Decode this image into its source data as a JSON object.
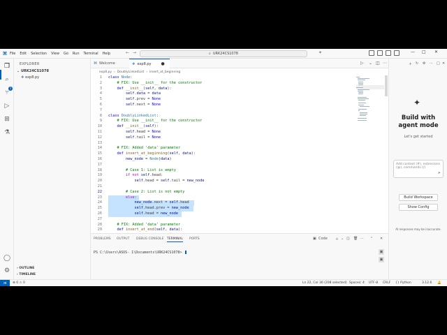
{
  "app": {
    "search_text": "URK24CS1078",
    "menu": [
      "File",
      "Edit",
      "Selection",
      "View",
      "Go",
      "Run",
      "Terminal",
      "Help"
    ]
  },
  "sidebar": {
    "header": "EXPLORER",
    "folder": "URK24CS1078",
    "file": "exp8.py",
    "outline": "OUTLINE",
    "timeline": "TIMELINE"
  },
  "tabs": [
    {
      "label": "Welcome"
    },
    {
      "label": "exp8.py"
    }
  ],
  "breadcrumb": [
    "exp8.py",
    "DoublyLinkedList",
    "insert_at_beginning"
  ],
  "editor": {
    "lines": [
      {
        "n": "1",
        "text": "class Node:"
      },
      {
        "n": "2",
        "text": "    # FIX: Use __init__ for the constructor"
      },
      {
        "n": "3",
        "text": "    def __init__(self, data):"
      },
      {
        "n": "4",
        "text": "        self.data = data"
      },
      {
        "n": "5",
        "text": "        self.prev = None"
      },
      {
        "n": "6",
        "text": "        self.next = None"
      },
      {
        "n": "7",
        "text": ""
      },
      {
        "n": "8",
        "text": "class DoublyLinkedList:"
      },
      {
        "n": "9",
        "text": "    # FIX: Use __init__ for the constructor"
      },
      {
        "n": "10",
        "text": "    def __init__(self):"
      },
      {
        "n": "11",
        "text": "        self.head = None"
      },
      {
        "n": "12",
        "text": "        self.tail = None"
      },
      {
        "n": "13",
        "text": ""
      },
      {
        "n": "14",
        "text": "    # FIX: Added 'data' parameter"
      },
      {
        "n": "15",
        "text": "    def insert_at_beginning(self, data):"
      },
      {
        "n": "16",
        "text": "        new_node = Node(data)"
      },
      {
        "n": "17",
        "text": ""
      },
      {
        "n": "18",
        "text": "        # Case 1: List is empty"
      },
      {
        "n": "19",
        "text": "        if not self.head:"
      },
      {
        "n": "20",
        "text": "            self.head = self.tail = new_node"
      },
      {
        "n": "21",
        "text": ""
      },
      {
        "n": "22",
        "text": "        # Case 2: List is not empty"
      },
      {
        "n": "23",
        "text": "        else:"
      },
      {
        "n": "24",
        "text": "            new_node.next = self.head"
      },
      {
        "n": "25",
        "text": "            self.head.prev = new_node"
      },
      {
        "n": "26",
        "text": "            self.head = new_node"
      },
      {
        "n": "27",
        "text": ""
      },
      {
        "n": "28",
        "text": "    # FIX: Added 'data' parameter"
      },
      {
        "n": "29",
        "text": "    def insert_at_end(self, data):"
      }
    ]
  },
  "panel": {
    "tabs": [
      "PROBLEMS",
      "OUTPUT",
      "DEBUG CONSOLE",
      "TERMINAL",
      "PORTS"
    ],
    "terminal_kind": "Code",
    "prompt": "PS C:\\Users\\ASUS- 1\\Documents\\URK24CS1078> "
  },
  "chat": {
    "title": "Build with agent mode",
    "subtitle": "Let's get started",
    "placeholder": "Add context (#), extensions (@), commands (/)",
    "button1": "Build Workspace",
    "button2": "Show Config",
    "note": "AI responses may be inaccurate."
  },
  "statusbar": {
    "problems": "0 ⚠ 0",
    "position": "Ln 22, Col 36 (208 selected)",
    "spaces": "Spaces: 4",
    "encoding": "UTF-8",
    "eol": "CRLF",
    "language": "Python",
    "version": "3.12.6"
  },
  "colors": {
    "accent": "#005fb8",
    "selection": "#add6ff",
    "keyword": "#0000ff",
    "comment": "#008000",
    "class": "#267f99"
  }
}
